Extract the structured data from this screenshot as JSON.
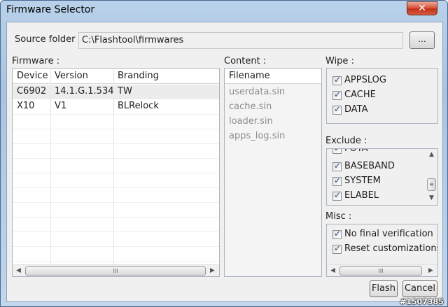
{
  "window": {
    "title": "Firmware Selector",
    "close_glyph": "✕"
  },
  "source": {
    "label": "Source folder",
    "path": "C:\\Flashtool\\firmwares",
    "browse_label": "..."
  },
  "firmware": {
    "label": "Firmware :",
    "columns": [
      "Device",
      "Version",
      "Branding"
    ],
    "rows": [
      {
        "device": "C6902",
        "version": "14.1.G.1.534",
        "branding": "TW"
      },
      {
        "device": "X10",
        "version": "V1",
        "branding": "BLRelock"
      }
    ]
  },
  "content": {
    "label": "Content :",
    "header": "Filename",
    "items": [
      "userdata.sin",
      "cache.sin",
      "loader.sin",
      "apps_log.sin"
    ]
  },
  "wipe": {
    "label": "Wipe :",
    "items": [
      {
        "label": "APPSLOG",
        "checked": true
      },
      {
        "label": "CACHE",
        "checked": true
      },
      {
        "label": "DATA",
        "checked": true
      }
    ]
  },
  "exclude": {
    "label": "Exclude :",
    "items": [
      {
        "label": "FOTA",
        "checked": true
      },
      {
        "label": "BASEBAND",
        "checked": true
      },
      {
        "label": "SYSTEM",
        "checked": true
      },
      {
        "label": "ELABEL",
        "checked": true
      }
    ]
  },
  "misc": {
    "label": "Misc :",
    "items": [
      {
        "label": "No final verification",
        "checked": true
      },
      {
        "label": "Reset customizations",
        "checked": true
      }
    ]
  },
  "buttons": {
    "flash": "Flash",
    "cancel": "Cancel"
  },
  "watermark": "#1507385"
}
